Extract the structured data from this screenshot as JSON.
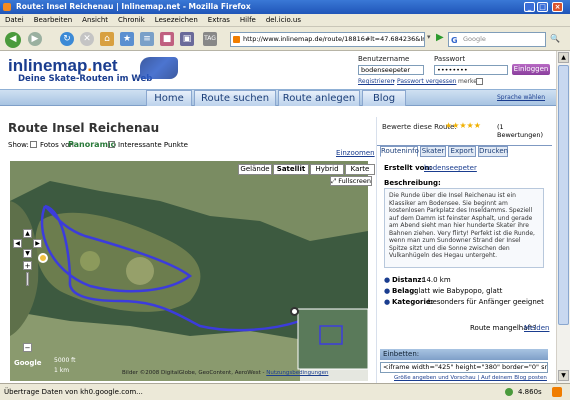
{
  "window": {
    "title": "Route: Insel Reichenau | Inlinemap.net - Mozilla Firefox"
  },
  "menu": [
    "Datei",
    "Bearbeiten",
    "Ansicht",
    "Chronik",
    "Lesezeichen",
    "Extras",
    "Hilfe",
    "del.icio.us"
  ],
  "toolbar": {
    "url": "http://www.inlinemap.de/route/18816#lt=47.684236&ln=9",
    "search_placeholder": "Google"
  },
  "site": {
    "logo_pre": "inlinemap",
    "logo_dot": ".",
    "logo_post": "net",
    "slogan": "Deine Skate-Routen im Web",
    "login": {
      "user_label": "Benutzername",
      "user_value": "bodenseepeter",
      "pass_label": "Passwort",
      "pass_value": "••••••••",
      "button": "Einloggen",
      "register": "Registrieren",
      "forgot": "Passwort vergessen",
      "remember": "merken"
    },
    "nav": [
      "Home",
      "Route suchen",
      "Route anlegen",
      "Blog"
    ],
    "language": "Sprache wählen"
  },
  "route": {
    "title": "Route Insel Reichenau",
    "zoom_link": "Einzoomen",
    "show_label": "Show:",
    "photos_label": "Fotos von",
    "panoramio_label": "Panoramio",
    "poi_label": "Interessante Punkte",
    "map_types": [
      "Gelände",
      "Satellit",
      "Hybrid",
      "Karte"
    ],
    "fullscreen": "Fullscreen",
    "scale_m": "5000 ft",
    "scale_km": "1 km",
    "copyright": "Bilder ©2008 DigitalGlobe, GeoContent, AeroWest -",
    "terms": "Nutzungsbedingungen",
    "google": "Google"
  },
  "panel": {
    "rating_label": "Bewerte diese Route:",
    "rating_count": "(1 Bewertungen)",
    "tabs": [
      "Routeninfo",
      "Skater",
      "Export",
      "Drucken"
    ],
    "created_label": "Erstellt von:",
    "created_by": "bodenseepeter",
    "desc_label": "Beschreibung:",
    "description": "Die Runde über die Insel Reichenau ist ein Klassiker am Bodensee. Sie beginnt am kostenlosen Parkplatz des Inseldamms. Speziell auf dem Damm ist feinster Asphalt, und gerade am Abend sieht man hier hunderte Skater ihre Bahnen ziehen. Very flirty! Perfekt ist die Runde, wenn man zum Sundowner Strand der Insel Spitze sitzt und die Sonne zwischen den Vulkanhügeln des Hegau untergeht.",
    "distance_label": "Distanz:",
    "distance": "14.0 km",
    "surface_label": "Belag:",
    "surface": "glatt wie Babypopo, glatt",
    "category_label": "Kategorie:",
    "category": "besonders für Anfänger geeignet",
    "defect_label": "Route mangelhaft?",
    "defect_link": "Melden",
    "embed_label": "Einbetten:",
    "embed_code": "<iframe width=\"425\" height=\"380\" border=\"0\" src",
    "embed_links": "Größe angeben und Vorschau | Auf deinem Blog posten"
  },
  "status": {
    "text": "Übertrage Daten von kh0.google.com...",
    "time": "4.860s"
  },
  "colors": {
    "route": "#3c3cdc",
    "brand": "#1a3d8f",
    "accent": "#f07d00"
  }
}
